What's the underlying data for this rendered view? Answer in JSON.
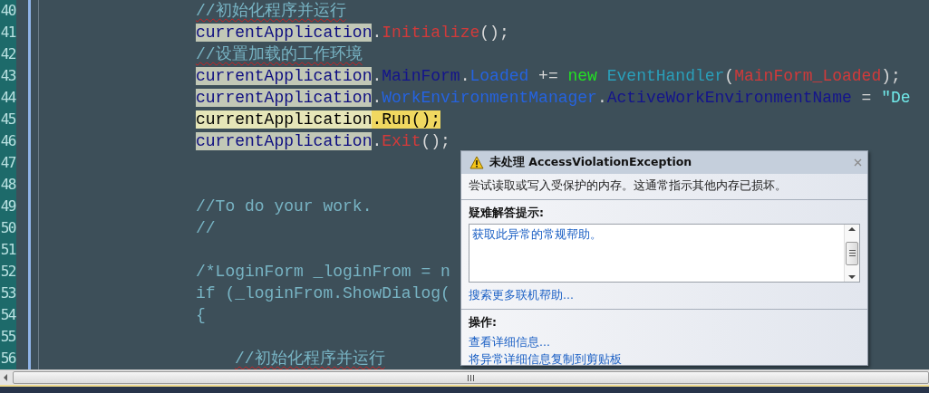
{
  "editor": {
    "lines": [
      {
        "number": "40",
        "tokens": [
          {
            "kind": "comment",
            "text": "//初始化程序并运行",
            "squiggle": true
          }
        ]
      },
      {
        "number": "41",
        "tokens": [
          {
            "kind": "ref",
            "text": "currentApplication"
          },
          {
            "kind": "punct",
            "text": "."
          },
          {
            "kind": "method",
            "text": "Initialize"
          },
          {
            "kind": "punct",
            "text": "();"
          }
        ]
      },
      {
        "number": "42",
        "tokens": [
          {
            "kind": "comment",
            "text": "//设置加载的工作环境",
            "squiggle": true
          }
        ]
      },
      {
        "number": "43",
        "tokens": [
          {
            "kind": "ref",
            "text": "currentApplication"
          },
          {
            "kind": "punct",
            "text": "."
          },
          {
            "kind": "member",
            "text": "MainForm"
          },
          {
            "kind": "punct",
            "text": "."
          },
          {
            "kind": "property",
            "text": "Loaded"
          },
          {
            "kind": "punct",
            "text": " += "
          },
          {
            "kind": "keyword",
            "text": "new "
          },
          {
            "kind": "type",
            "text": "EventHandler"
          },
          {
            "kind": "punct",
            "text": "("
          },
          {
            "kind": "method",
            "text": "MainForm_Loaded"
          },
          {
            "kind": "punct",
            "text": ");"
          }
        ]
      },
      {
        "number": "44",
        "tokens": [
          {
            "kind": "ref",
            "text": "currentApplication"
          },
          {
            "kind": "punct",
            "text": "."
          },
          {
            "kind": "property",
            "text": "WorkEnvironmentManager"
          },
          {
            "kind": "punct",
            "text": "."
          },
          {
            "kind": "member",
            "text": "ActiveWorkEnvironmentName"
          },
          {
            "kind": "punct",
            "text": " = "
          },
          {
            "kind": "string",
            "text": "\"De"
          }
        ]
      },
      {
        "number": "45",
        "tokens": [
          {
            "kind": "current-ref",
            "text": "currentApplication"
          },
          {
            "kind": "current",
            "text": ".Run();"
          }
        ]
      },
      {
        "number": "46",
        "tokens": [
          {
            "kind": "ref",
            "text": "currentApplication"
          },
          {
            "kind": "punct",
            "text": "."
          },
          {
            "kind": "method",
            "text": "Exit"
          },
          {
            "kind": "punct",
            "text": "();"
          }
        ]
      },
      {
        "number": "47"
      },
      {
        "number": "48"
      },
      {
        "number": "49",
        "tokens": [
          {
            "kind": "comment",
            "text": "//To do your work.",
            "squiggle": false
          }
        ]
      },
      {
        "number": "50",
        "tokens": [
          {
            "kind": "comment",
            "text": "//",
            "squiggle": false
          }
        ]
      },
      {
        "number": "51"
      },
      {
        "number": "52",
        "tokens": [
          {
            "kind": "comment",
            "text": "/*LoginForm _loginFrom = n",
            "squiggle": false
          }
        ]
      },
      {
        "number": "53",
        "tokens": [
          {
            "kind": "comment",
            "text": "if (_loginFrom.ShowDialog(",
            "squiggle": false
          }
        ]
      },
      {
        "number": "54",
        "tokens": [
          {
            "kind": "comment",
            "text": "{",
            "squiggle": false
          }
        ],
        "children": [
          {
            "number": "55"
          },
          {
            "number": "56",
            "tokens": [
              {
                "kind": "comment",
                "text": "//初始化程序并运行",
                "squiggle": true
              }
            ]
          }
        ]
      }
    ]
  },
  "exception_dialog": {
    "title": "未处理 AccessViolationException",
    "message": "尝试读取或写入受保护的内存。这通常指示其他内存已损坏。",
    "tips_heading": "疑难解答提示:",
    "tips": [
      "获取此异常的常规帮助。"
    ],
    "search_link": "搜索更多联机帮助...",
    "actions_heading": "操作:",
    "actions": [
      "查看详细信息...",
      "将异常详细信息复制到剪贴板"
    ]
  }
}
